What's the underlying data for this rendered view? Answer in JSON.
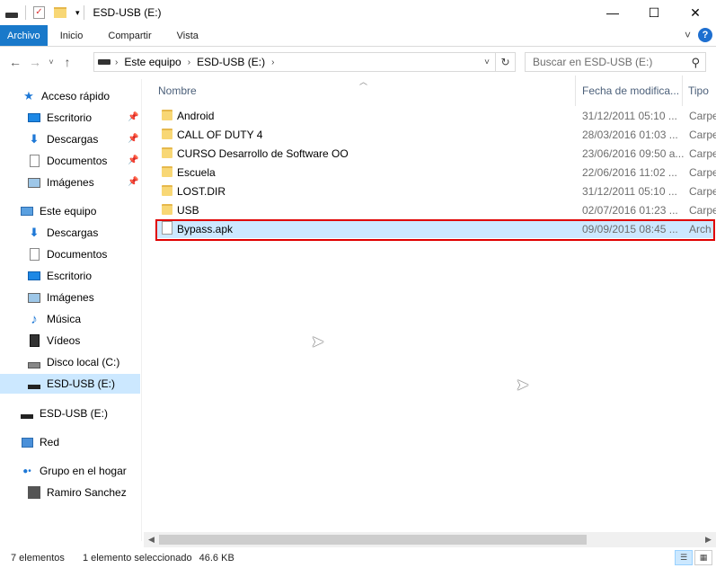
{
  "window": {
    "title": "ESD-USB (E:)",
    "minimize_glyph": "—",
    "maximize_glyph": "☐",
    "close_glyph": "✕"
  },
  "ribbon": {
    "tabs": [
      "Archivo",
      "Inicio",
      "Compartir",
      "Vista"
    ],
    "expand_glyph": "˅",
    "help_glyph": "?"
  },
  "address": {
    "crumbs": [
      "Este equipo",
      "ESD-USB (E:)"
    ],
    "search_placeholder": "Buscar en ESD-USB (E:)"
  },
  "nav": {
    "quick_access": "Acceso rápido",
    "quick_items": [
      "Escritorio",
      "Descargas",
      "Documentos",
      "Imágenes"
    ],
    "this_pc": "Este equipo",
    "pc_items": [
      "Descargas",
      "Documentos",
      "Escritorio",
      "Imágenes",
      "Música",
      "Vídeos",
      "Disco local (C:)",
      "ESD-USB (E:)"
    ],
    "usb_root": "ESD-USB (E:)",
    "network": "Red",
    "homegroup": "Grupo en el hogar",
    "user": "Ramiro Sanchez"
  },
  "columns": {
    "name": "Nombre",
    "date": "Fecha de modifica...",
    "type": "Tipo"
  },
  "files": [
    {
      "name": "Android",
      "date": "31/12/2011 05:10 ...",
      "type": "Carpe",
      "kind": "folder"
    },
    {
      "name": "CALL OF DUTY 4",
      "date": "28/03/2016 01:03 ...",
      "type": "Carpe",
      "kind": "folder"
    },
    {
      "name": "CURSO Desarrollo de Software OO",
      "date": "23/06/2016 09:50 a...",
      "type": "Carpe",
      "kind": "folder"
    },
    {
      "name": "Escuela",
      "date": "22/06/2016 11:02 ...",
      "type": "Carpe",
      "kind": "folder"
    },
    {
      "name": "LOST.DIR",
      "date": "31/12/2011 05:10 ...",
      "type": "Carpe",
      "kind": "folder"
    },
    {
      "name": "USB",
      "date": "02/07/2016 01:23 ...",
      "type": "Carpe",
      "kind": "folder"
    },
    {
      "name": "Bypass.apk",
      "date": "09/09/2015 08:45 ...",
      "type": "Arch",
      "kind": "file"
    }
  ],
  "status": {
    "count": "7 elementos",
    "selection": "1 elemento seleccionado",
    "size": "46.6 KB"
  }
}
